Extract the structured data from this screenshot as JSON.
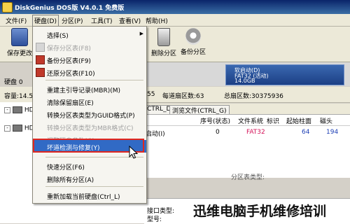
{
  "window": {
    "title": "DiskGenius DOS版 V4.0.1 免费版"
  },
  "menubar": {
    "items": [
      "文件(F)",
      "硬盘(D)",
      "分区(P)",
      "工具(T)",
      "查看(V)",
      "帮助(H)"
    ]
  },
  "toolbar": {
    "save_label": "保存更改",
    "delete_label": "删除分区",
    "backup_label": "备份分区"
  },
  "disk_panel": {
    "label": "硬盘 0",
    "capacity_label": "容量:14.5",
    "partition_name": "软启动(D)",
    "partition_fs": "FAT32 (活动)",
    "partition_size": "14.0GB"
  },
  "info_strip": {
    "heads_fragment": "55",
    "sectors_label": "每道扇区数:63",
    "total_sectors_label": "总扇区数:30375936"
  },
  "tree": {
    "items": [
      "HD0",
      "HD1"
    ]
  },
  "tabs": {
    "partition_params": "CTRL_D)",
    "browse_files": "浏览文件(CTRL_G)"
  },
  "table": {
    "headers": [
      "序号(状态)",
      "文件系统",
      "标识",
      "起始柱面",
      "磁头"
    ],
    "row": {
      "name": "启动(I)",
      "index": "0",
      "fs": "FAT32",
      "cyl": "64",
      "head": "194"
    }
  },
  "bottom": {
    "interface_label": "接口类型:",
    "model_label": "型号:",
    "partition_table_label": "分区表类型:"
  },
  "menu": {
    "items": [
      {
        "label": "选择(S)",
        "disabled": false,
        "arrow": true
      },
      {
        "label": "保存分区表(F8)",
        "disabled": true
      },
      {
        "label": "备份分区表(F9)",
        "disabled": false
      },
      {
        "label": "还原分区表(F10)",
        "disabled": false
      },
      {
        "label": "重建主引导记录(MBR)(M)",
        "disabled": false
      },
      {
        "label": "清除保留扇区(E)",
        "disabled": false
      },
      {
        "label": "转换分区表类型为GUID格式(P)",
        "disabled": false
      },
      {
        "label": "转换分区表类型为MBR格式(C)",
        "disabled": true
      },
      {
        "label": "调整硬盘参数(G)",
        "disabled": true
      },
      {
        "label": "坏道检测与修复(Y)",
        "disabled": false,
        "highlighted": true
      },
      {
        "label": "快速分区(F6)",
        "disabled": false
      },
      {
        "label": "删除所有分区(A)",
        "disabled": false
      },
      {
        "label": "重新加载当前硬盘(Ctrl_L)",
        "disabled": false
      }
    ]
  },
  "watermark": "迅维电脑手机维修培训",
  "colors": {
    "title_bar": "#0a246a",
    "highlight": "#316ac5",
    "annotation_box": "#e0271f",
    "fat32": "#d4145a"
  }
}
